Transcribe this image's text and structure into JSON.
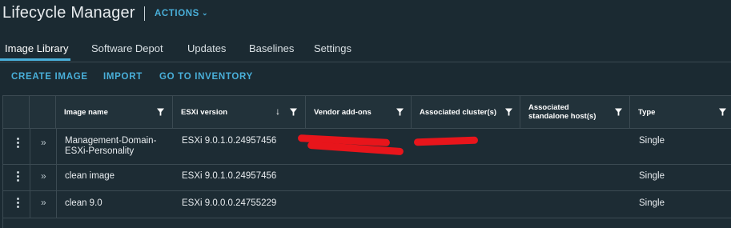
{
  "header": {
    "app_title": "Lifecycle Manager",
    "actions_label": "ACTIONS"
  },
  "tabs": [
    {
      "label": "Image Library",
      "active": true
    },
    {
      "label": "Software Depot",
      "active": false
    },
    {
      "label": "Updates",
      "active": false
    },
    {
      "label": "Baselines",
      "active": false
    },
    {
      "label": "Settings",
      "active": false
    }
  ],
  "toolbar": {
    "create_image": "CREATE IMAGE",
    "import": "IMPORT",
    "go_to_inventory": "GO TO INVENTORY"
  },
  "table": {
    "columns": {
      "image_name": "Image name",
      "esxi_version": "ESXi version",
      "vendor_addons": "Vendor add-ons",
      "associated_clusters": "Associated cluster(s)",
      "associated_hosts": "Associated standalone host(s)",
      "type": "Type"
    },
    "rows": [
      {
        "image_name": "Management-Domain-ESXi-Personality",
        "esxi_version": "ESXi 9.0.1.0.24957456",
        "vendor_addons": "",
        "associated_clusters": "",
        "associated_hosts": "",
        "type": "Single"
      },
      {
        "image_name": "clean image",
        "esxi_version": "ESXi 9.0.1.0.24957456",
        "vendor_addons": "",
        "associated_clusters": "",
        "associated_hosts": "",
        "type": "Single"
      },
      {
        "image_name": "clean 9.0",
        "esxi_version": "ESXi 9.0.0.0.24755229",
        "vendor_addons": "",
        "associated_clusters": "",
        "associated_hosts": "",
        "type": "Single"
      }
    ]
  },
  "colors": {
    "background": "#1b2a32",
    "accent": "#49afd9",
    "redaction": "#e8151b"
  }
}
